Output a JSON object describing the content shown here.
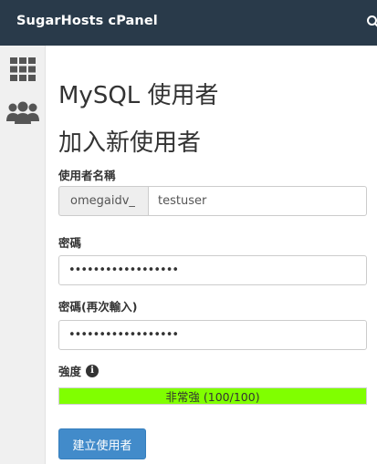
{
  "header": {
    "brand": "SugarHosts cPanel",
    "search_icon": "search-icon"
  },
  "sidebar": {
    "items": [
      {
        "icon": "grid-icon"
      },
      {
        "icon": "users-icon"
      }
    ]
  },
  "page": {
    "title": "MySQL 使用者",
    "section_title": "加入新使用者"
  },
  "form": {
    "username_label": "使用者名稱",
    "username_prefix": "omegaidv_",
    "username_value": "testuser",
    "password_label": "密碼",
    "password_value": "••••••••••••••••••",
    "password_again_label": "密碼(再次輸入)",
    "password_again_value": "••••••••••••••••••",
    "strength_label": "強度",
    "strength_text": "非常強 (100/100)",
    "strength_score": 100,
    "strength_color": "#80ff00",
    "submit_label": "建立使用者"
  }
}
